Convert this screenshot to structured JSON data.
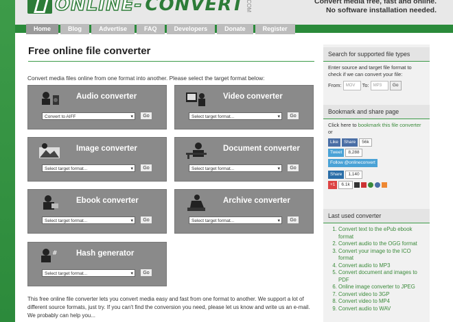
{
  "brand": {
    "logo_part1": "ONLINE-",
    "logo_part2": "CONVERT",
    "logo_tld": ".COM"
  },
  "header": {
    "tagline_line1": "Convert media free, fast and online.",
    "tagline_line2": "No software installation needed."
  },
  "nav": [
    "Home",
    "Blog",
    "Advertise",
    "FAQ",
    "Developers",
    "Donate",
    "Register"
  ],
  "main": {
    "title": "Free online file converter",
    "intro": "Convert media files online from one format into another. Please select the target format below:",
    "converters": [
      {
        "title": "Audio converter",
        "select": "Convert to AIFF",
        "go": "Go",
        "icon": "audio-icon"
      },
      {
        "title": "Video converter",
        "select": "Select target format...",
        "go": "Go",
        "icon": "video-icon"
      },
      {
        "title": "Image converter",
        "select": "Select target format...",
        "go": "Go",
        "icon": "image-icon"
      },
      {
        "title": "Document converter",
        "select": "Select target format...",
        "go": "Go",
        "icon": "document-icon"
      },
      {
        "title": "Ebook converter",
        "select": "Select target format...",
        "go": "Go",
        "icon": "ebook-icon"
      },
      {
        "title": "Archive converter",
        "select": "Select target format...",
        "go": "Go",
        "icon": "archive-icon"
      },
      {
        "title": "Hash generator",
        "select": "Select target format...",
        "go": "Go",
        "icon": "hash-icon"
      }
    ],
    "bottom_text": "This free online file converter lets you convert media easy and fast from one format to another. We support a lot of different source formats, just try. If you can't find the conversion you need, please let us know and write us an e-mail. We probably can help you..."
  },
  "sidebar": {
    "search": {
      "title": "Search for supported file types",
      "text": "Enter source and target file format to check if we can convert your file:",
      "from_label": "From:",
      "from_placeholder": "MOV",
      "to_label": "To:",
      "to_placeholder": "MP3",
      "go": "Go"
    },
    "bookmark": {
      "title": "Bookmark and share page",
      "text_pre": "Click here to ",
      "text_link": "bookmark this file converter",
      "text_post": " or",
      "like": "Like",
      "share": "Share",
      "like_count": "56k",
      "tweet": "Tweet",
      "tweet_count": "8,288",
      "follow": "Follow @onlineconvert",
      "in_share": "Share",
      "in_count": "1,140",
      "gplus": "+1",
      "gplus_count": "6.1k"
    },
    "last_used": {
      "title": "Last used converter",
      "items": [
        "Convert text to the ePub ebook format",
        "Convert audio to the OGG format",
        "Convert your image to the ICO format",
        "Convert audio to MP3",
        "Convert document and images to PDF",
        "Online image converter to JPEG",
        "Convert video to 3GP",
        "Convert video to MP4",
        "Convert audio to WAV"
      ]
    }
  }
}
